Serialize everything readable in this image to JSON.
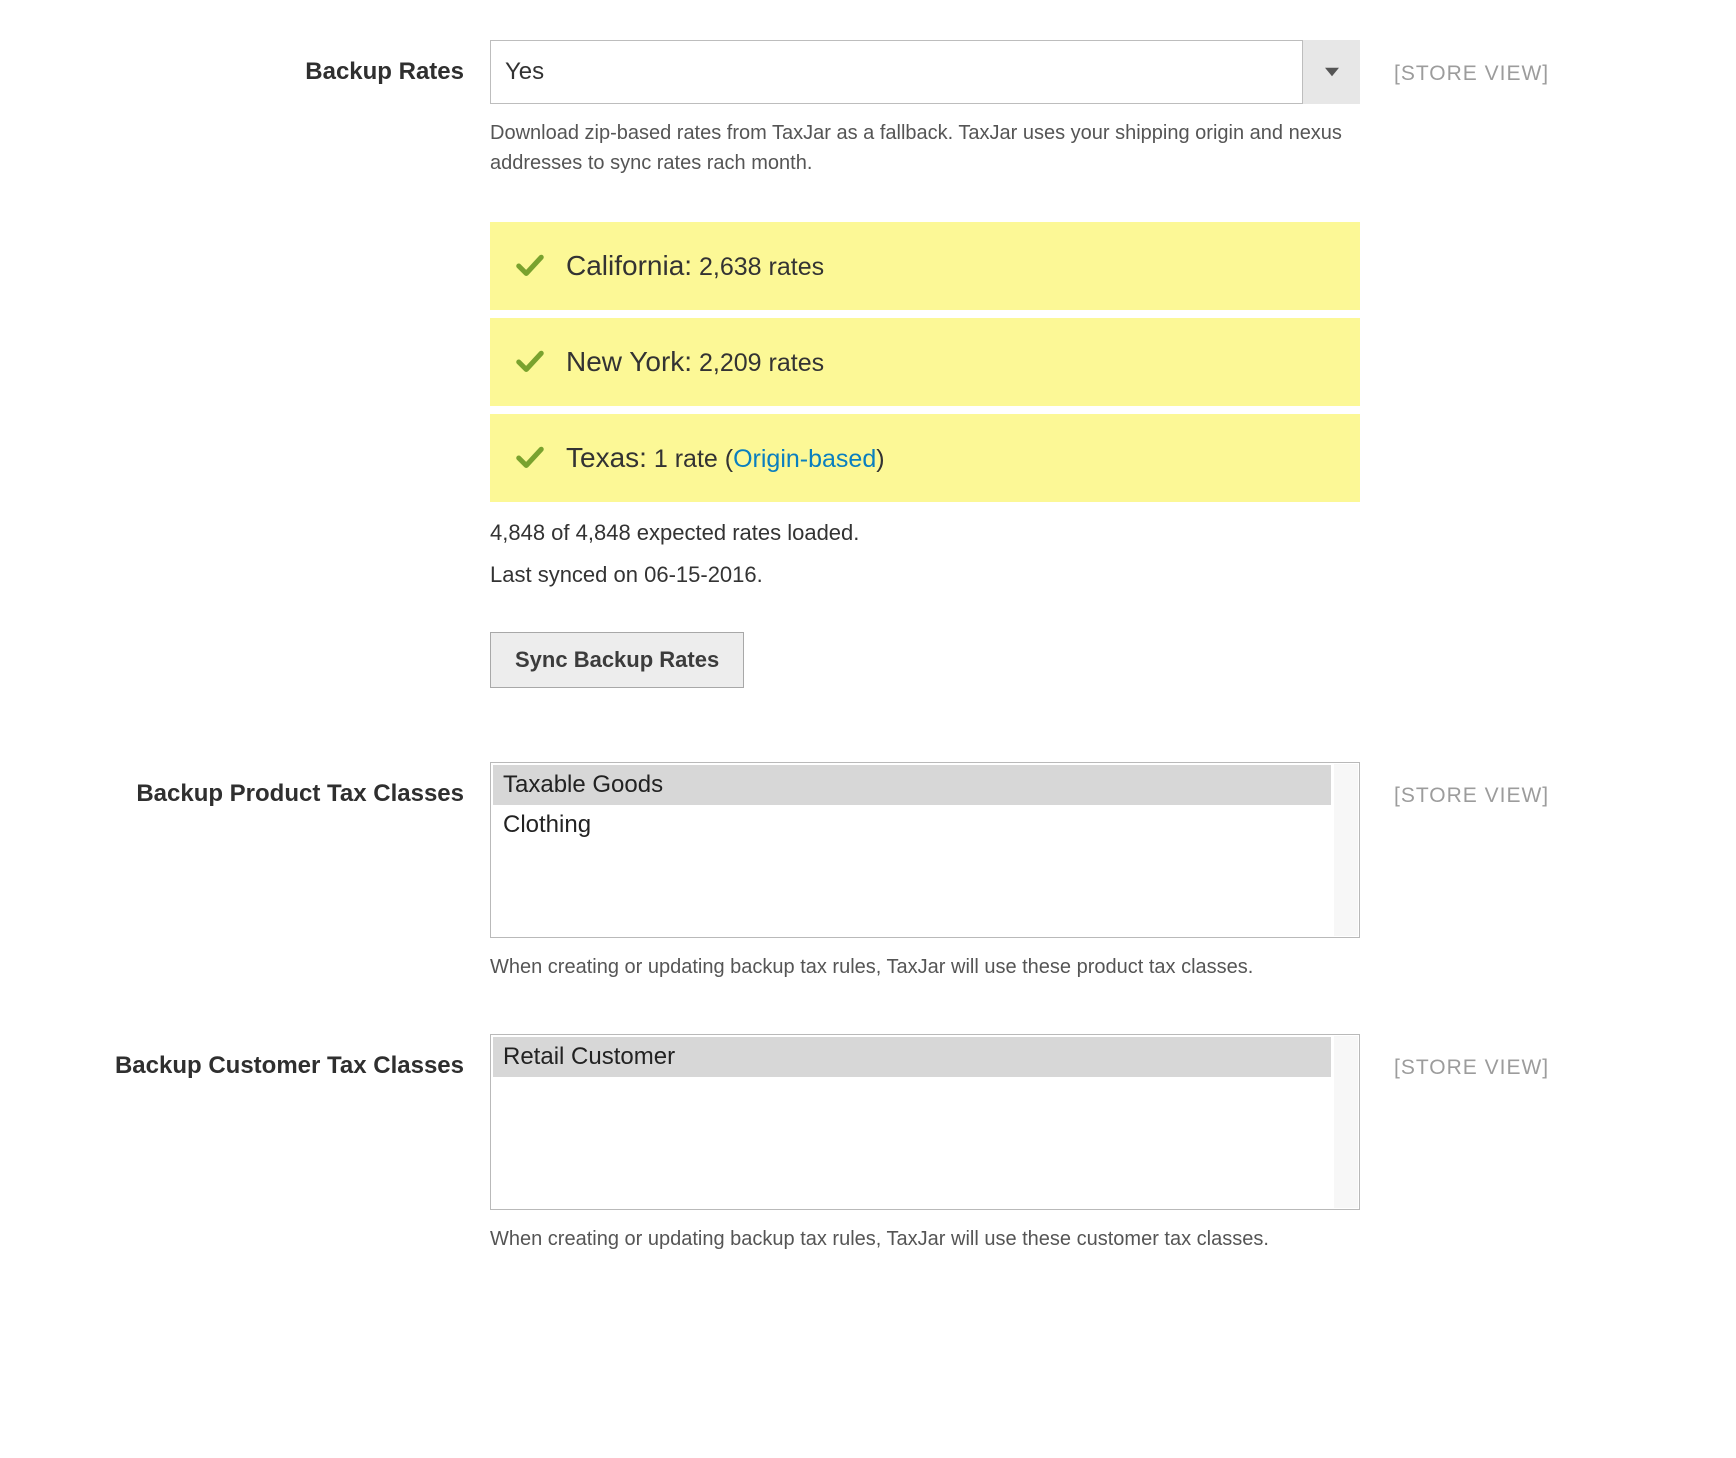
{
  "scope_label": "[STORE VIEW]",
  "colors": {
    "highlight": "#fcf896",
    "check": "#79a22e",
    "link": "#0a7fbf"
  },
  "backup_rates": {
    "label": "Backup Rates",
    "value": "Yes",
    "help": "Download zip-based rates from TaxJar as a fallback. TaxJar uses your shipping origin and nexus addresses to sync rates rach month.",
    "states": [
      {
        "name": "California",
        "count_text": "2,638 rates",
        "origin_based": false
      },
      {
        "name": "New York",
        "count_text": "2,209 rates",
        "origin_based": false
      },
      {
        "name": "Texas",
        "count_text": "1 rate",
        "origin_based": true
      }
    ],
    "origin_link_text": "Origin-based",
    "summary": "4,848 of 4,848 expected rates loaded.",
    "last_synced": "Last synced on 06-15-2016.",
    "sync_button": "Sync Backup Rates"
  },
  "product_classes": {
    "label": "Backup Product Tax Classes",
    "options": [
      {
        "text": "Taxable Goods",
        "selected": true
      },
      {
        "text": "Clothing",
        "selected": false
      }
    ],
    "help": "When creating or updating backup tax rules, TaxJar will use these product tax classes."
  },
  "customer_classes": {
    "label": "Backup Customer Tax Classes",
    "options": [
      {
        "text": "Retail Customer",
        "selected": true
      }
    ],
    "help": "When creating or updating backup tax rules, TaxJar will use these customer tax classes."
  }
}
